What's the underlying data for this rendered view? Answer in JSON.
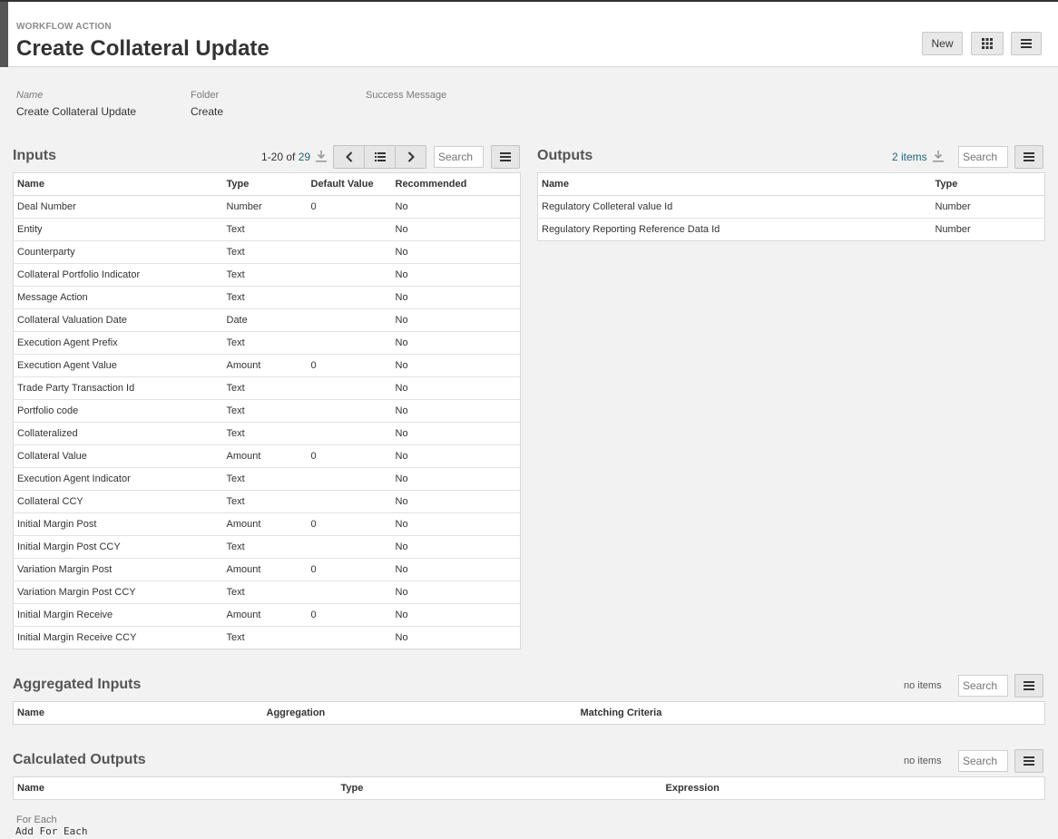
{
  "header": {
    "eyebrow": "WORKFLOW ACTION",
    "title": "Create Collateral Update",
    "new_label": "New"
  },
  "properties": {
    "name_label": "Name",
    "name_value": "Create Collateral Update",
    "folder_label": "Folder",
    "folder_value": "Create",
    "success_label": "Success Message",
    "success_value": ""
  },
  "inputs": {
    "title": "Inputs",
    "range": "1-20 of ",
    "total": "29",
    "search_placeholder": "Search",
    "columns": [
      "Name",
      "Type",
      "Default Value",
      "Recommended"
    ],
    "rows": [
      [
        "Deal Number",
        "Number",
        "0",
        "No"
      ],
      [
        "Entity",
        "Text",
        "",
        "No"
      ],
      [
        "Counterparty",
        "Text",
        "",
        "No"
      ],
      [
        "Collateral Portfolio Indicator",
        "Text",
        "",
        "No"
      ],
      [
        "Message Action",
        "Text",
        "",
        "No"
      ],
      [
        "Collateral Valuation Date",
        "Date",
        "",
        "No"
      ],
      [
        "Execution Agent Prefix",
        "Text",
        "",
        "No"
      ],
      [
        "Execution Agent Value",
        "Amount",
        "0",
        "No"
      ],
      [
        "Trade Party Transaction Id",
        "Text",
        "",
        "No"
      ],
      [
        "Portfolio code",
        "Text",
        "",
        "No"
      ],
      [
        "Collateralized",
        "Text",
        "",
        "No"
      ],
      [
        "Collateral Value",
        "Amount",
        "0",
        "No"
      ],
      [
        "Execution Agent Indicator",
        "Text",
        "",
        "No"
      ],
      [
        "Collateral CCY",
        "Text",
        "",
        "No"
      ],
      [
        "Initial Margin Post",
        "Amount",
        "0",
        "No"
      ],
      [
        "Initial Margin Post CCY",
        "Text",
        "",
        "No"
      ],
      [
        "Variation Margin Post",
        "Amount",
        "0",
        "No"
      ],
      [
        "Variation Margin Post CCY",
        "Text",
        "",
        "No"
      ],
      [
        "Initial Margin Receive",
        "Amount",
        "0",
        "No"
      ],
      [
        "Initial Margin Receive CCY",
        "Text",
        "",
        "No"
      ]
    ]
  },
  "outputs": {
    "title": "Outputs",
    "count": "2 items",
    "search_placeholder": "Search",
    "columns": [
      "Name",
      "Type"
    ],
    "rows": [
      [
        "Regulatory Colleteral value Id",
        "Number"
      ],
      [
        "Regulatory Reporting Reference Data Id",
        "Number"
      ]
    ]
  },
  "aggregated_inputs": {
    "title": "Aggregated Inputs",
    "count": "no items",
    "search_placeholder": "Search",
    "columns": [
      "Name",
      "Aggregation",
      "Matching Criteria"
    ]
  },
  "calculated_outputs": {
    "title": "Calculated Outputs",
    "count": "no items",
    "search_placeholder": "Search",
    "columns": [
      "Name",
      "Type",
      "Expression"
    ]
  },
  "for_each": {
    "label": "For Each",
    "add_label": "Add For Each"
  },
  "colors": {
    "link": "#226677",
    "header_bar": "#555555",
    "background": "#f2f2f2"
  },
  "icons": [
    "grid-icon",
    "menu-icon",
    "download-icon",
    "chevron-left-icon",
    "list-icon",
    "chevron-right-icon"
  ]
}
